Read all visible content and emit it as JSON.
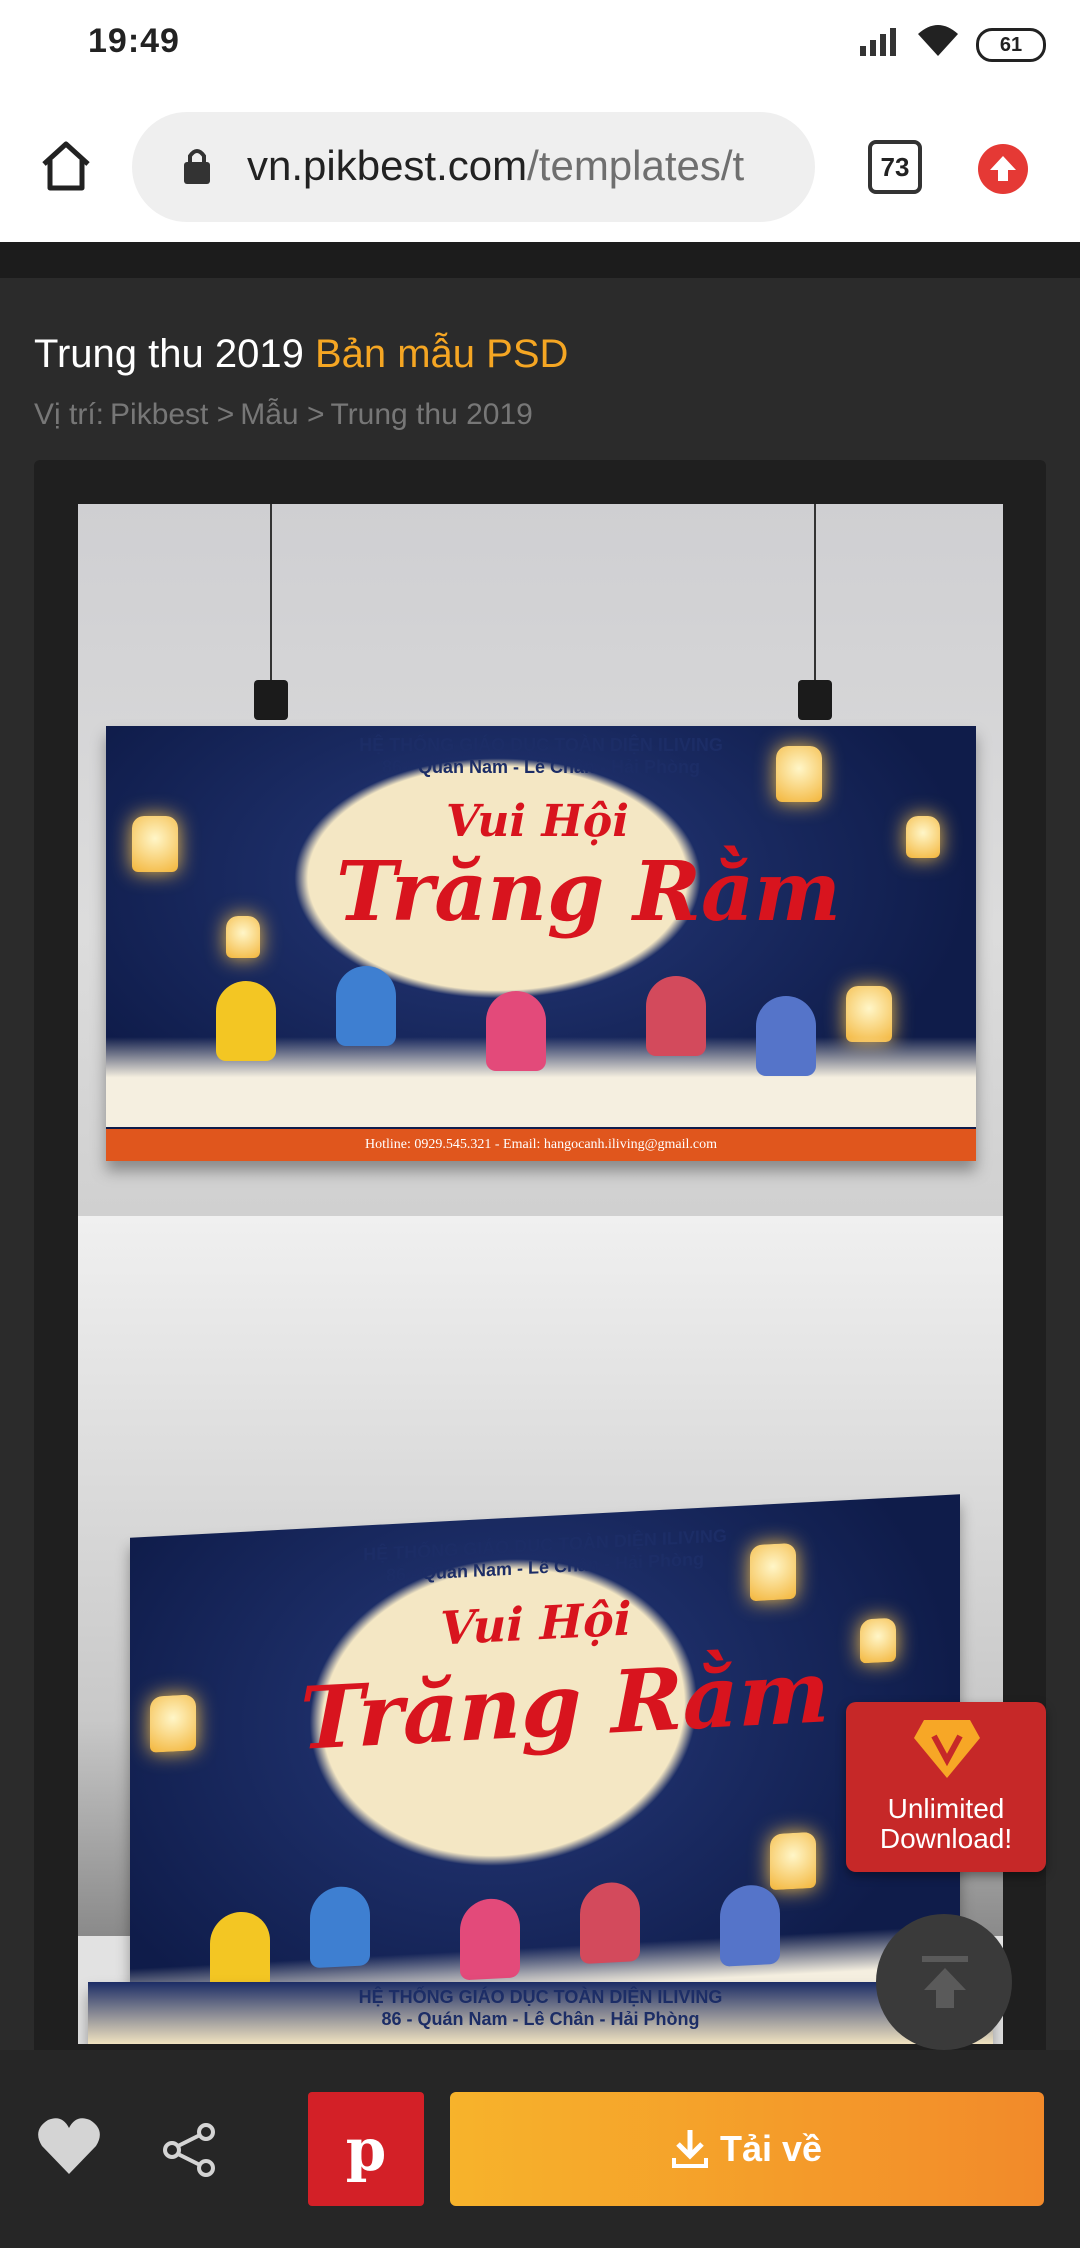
{
  "status_bar": {
    "time": "19:49",
    "battery": "61"
  },
  "browser": {
    "url_host": "vn.pikbest.com",
    "url_path": "/templates/t",
    "tab_count": "73"
  },
  "page": {
    "title_main": "Trung thu 2019",
    "title_accent": "Bản mẫu PSD",
    "breadcrumb": [
      "Vị trí:",
      "Pikbest >",
      "Mẫu >",
      "Trung thu 2019"
    ]
  },
  "preview": {
    "banner_line1": "HỆ THỐNG GIÁO DỤC TOÀN DIỆN ILIVING",
    "banner_line2": "86 - Quán Nam - Lê Chân - Hải Phòng",
    "banner_script_small": "Vui Hội",
    "banner_script_big": "Trăng Rằm",
    "banner_footer": "Hotline: 0929.545.321 - Email: hangocanh.iliving@gmail.com"
  },
  "promo": {
    "label_line1": "Unlimited",
    "label_line2": "Download!"
  },
  "actions": {
    "download_label": "Tải về",
    "pinterest_label": "p"
  },
  "colors": {
    "accent": "#f5a623",
    "pinterest": "#d32027",
    "download_start": "#f7b32b",
    "download_end": "#f28a2a",
    "promo_bg": "#c62828"
  }
}
